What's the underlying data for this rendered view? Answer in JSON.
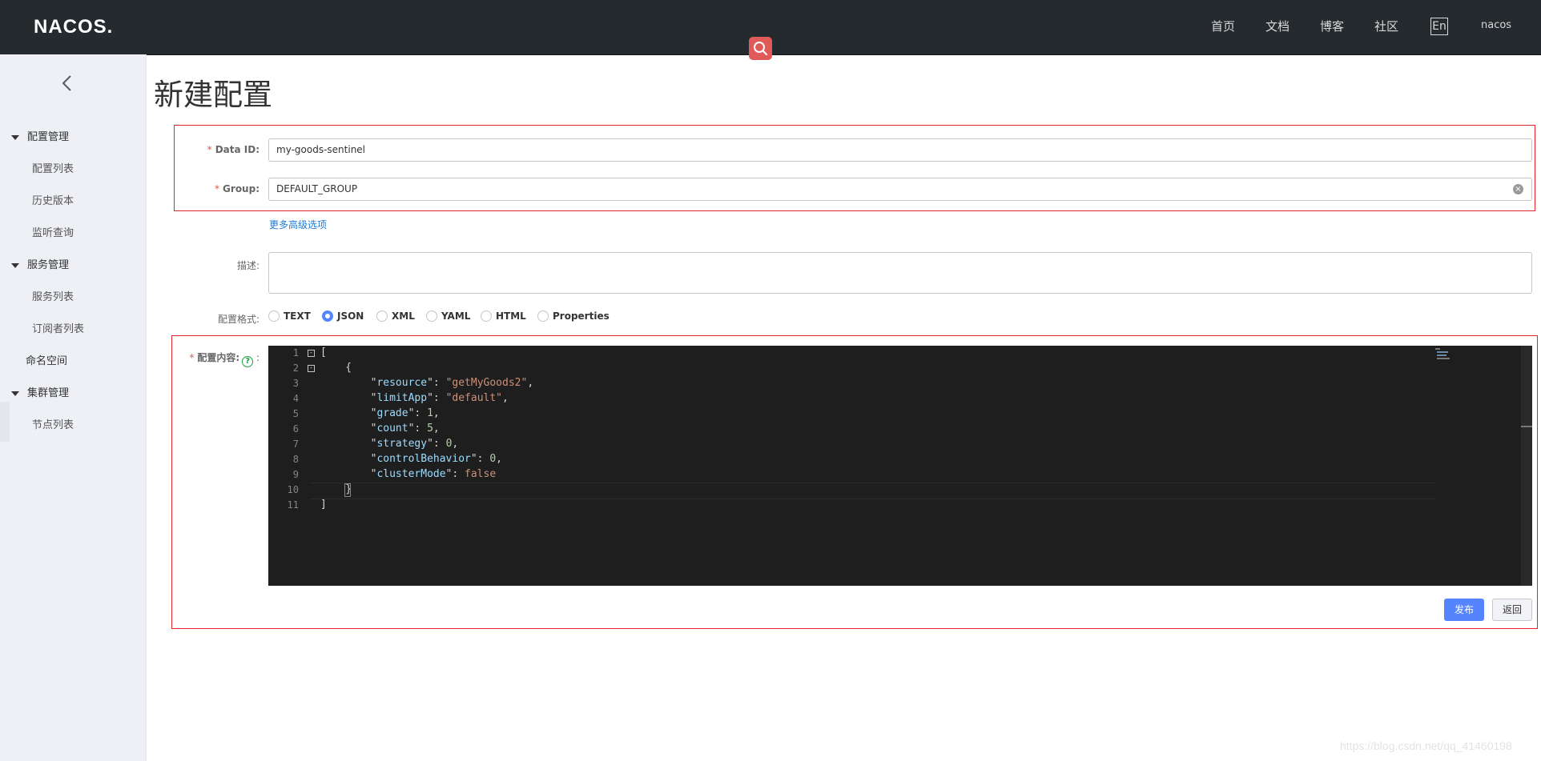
{
  "header": {
    "logo": "NACOS.",
    "nav": [
      "首页",
      "文档",
      "博客",
      "社区"
    ],
    "lang": "En",
    "user": "nacos"
  },
  "sidebar": {
    "groups": [
      {
        "label": "配置管理",
        "items": [
          "配置列表",
          "历史版本",
          "监听查询"
        ]
      },
      {
        "label": "服务管理",
        "items": [
          "服务列表",
          "订阅者列表"
        ]
      },
      {
        "label": "命名空间"
      },
      {
        "label": "集群管理",
        "items": [
          "节点列表"
        ]
      }
    ]
  },
  "page": {
    "title": "新建配置"
  },
  "form": {
    "data_id": {
      "label": "Data ID:",
      "value": "my-goods-sentinel"
    },
    "group": {
      "label": "Group:",
      "value": "DEFAULT_GROUP"
    },
    "advanced_link": "更多高级选项",
    "description": {
      "label": "描述:",
      "value": ""
    },
    "format": {
      "label": "配置格式:",
      "options": [
        "TEXT",
        "JSON",
        "XML",
        "YAML",
        "HTML",
        "Properties"
      ],
      "selected": "JSON"
    },
    "content": {
      "label": "配置内容:",
      "line_numbers": [
        "1",
        "2",
        "3",
        "4",
        "5",
        "6",
        "7",
        "8",
        "9",
        "10",
        "11"
      ],
      "entries": [
        {
          "key": "resource",
          "value": "\"getMyGoods2\""
        },
        {
          "key": "limitApp",
          "value": "\"default\""
        },
        {
          "key": "grade",
          "value": "1"
        },
        {
          "key": "count",
          "value": "5"
        },
        {
          "key": "strategy",
          "value": "0"
        },
        {
          "key": "controlBehavior",
          "value": "0"
        },
        {
          "key": "clusterMode",
          "value": "false"
        }
      ]
    }
  },
  "buttons": {
    "publish": "发布",
    "back": "返回"
  },
  "watermark": "https://blog.csdn.net/qq_41460198",
  "colors": {
    "primary": "#5584ff",
    "topbar": "#252a2f",
    "sidebar": "#eef0f5",
    "annotation": "#e0262a",
    "link": "#1f7bd8"
  }
}
